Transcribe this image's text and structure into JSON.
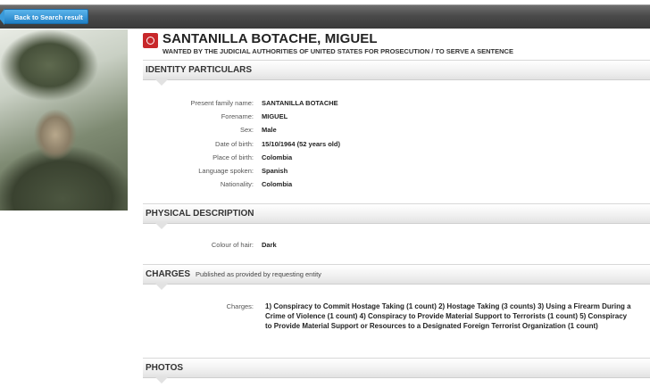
{
  "nav": {
    "back_label": "Back to Search result"
  },
  "person": {
    "name": "SANTANILLA BOTACHE, MIGUEL",
    "wanted_by": "WANTED BY THE JUDICIAL AUTHORITIES OF UNITED STATES FOR PROSECUTION / TO SERVE A SENTENCE"
  },
  "sections": {
    "identity": "IDENTITY PARTICULARS",
    "physical": "PHYSICAL DESCRIPTION",
    "charges": "CHARGES",
    "charges_sub": "Published as provided by requesting entity",
    "photos": "PHOTOS"
  },
  "identity": [
    {
      "label": "Present family name:",
      "value": "SANTANILLA BOTACHE"
    },
    {
      "label": "Forename:",
      "value": "MIGUEL"
    },
    {
      "label": "Sex:",
      "value": "Male"
    },
    {
      "label": "Date of birth:",
      "value": "15/10/1964 (52 years old)"
    },
    {
      "label": "Place of birth:",
      "value": "Colombia"
    },
    {
      "label": "Language spoken:",
      "value": "Spanish"
    },
    {
      "label": "Nationality:",
      "value": "Colombia"
    }
  ],
  "physical": [
    {
      "label": "Colour of hair:",
      "value": "Dark"
    }
  ],
  "charges": {
    "label": "Charges:",
    "value": "1) Conspiracy to Commit Hostage Taking (1 count) 2) Hostage Taking (3 counts) 3) Using a Firearm During a Crime of Violence (1 count) 4) Conspiracy to Provide Material Support to Terrorists (1 count) 5) Conspiracy to Provide Material Support or Resources to a Designated Foreign Terrorist Organization (1 count)"
  },
  "icons": {
    "emblem": "red-notice-emblem-icon",
    "back": "back-arrow-icon"
  },
  "colors": {
    "accent_blue": "#2a8fd6",
    "emblem_red": "#c8282b",
    "topbar": "#4a4a4a"
  }
}
